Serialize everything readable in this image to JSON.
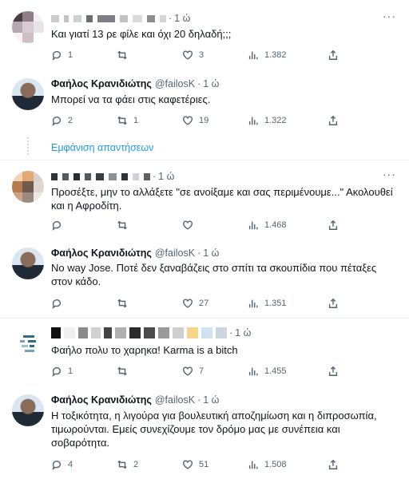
{
  "colors": {
    "link": "#1d9bf0",
    "muted": "#536471",
    "divider": "#eff3f4"
  },
  "tweets": [
    {
      "name": "",
      "handle": "",
      "time": "1 ώ",
      "text": "Και γιατί 13 ρε φίλε και όχι 20 δηλαδή;;;",
      "replies": "1",
      "retweets": "",
      "likes": "3",
      "views": "1.382"
    },
    {
      "name": "Φαήλος Κρανιδιώτης",
      "handle": "@failosK",
      "time": "1 ώ",
      "text": "Μπορεί να τα φάει στις καφετέριες.",
      "replies": "2",
      "retweets": "1",
      "likes": "19",
      "views": "1.322"
    },
    {
      "name": "",
      "handle": "",
      "time": "1 ώ",
      "text": "Προσέξτε, μην το αλλάξετε \"σε ανοίξαμε και σας περιμένουμε...\" Ακολουθεί και η Αφροδίτη.",
      "replies": "",
      "retweets": "",
      "likes": "",
      "views": "1.468"
    },
    {
      "name": "Φαήλος Κρανιδιώτης",
      "handle": "@failosK",
      "time": "1 ώ",
      "text": "No way Jose. Ποτέ δεν ξαναβάζεις στο σπίτι τα σκουπίδια που πέταξες στον κάδο.",
      "replies": "",
      "retweets": "",
      "likes": "27",
      "views": "1.351"
    },
    {
      "name": "",
      "handle": "",
      "time": "1 ώ",
      "text": "Φαήλο πολυ το χαρηκα! Karma is a bitch",
      "replies": "1",
      "retweets": "",
      "likes": "7",
      "views": "1.455"
    },
    {
      "name": "Φαήλος Κρανιδιώτης",
      "handle": "@failosK",
      "time": "1 ώ",
      "text": "Η τοξικότητα, η λιγούρα για βουλευτική αποζημίωση και η διπροσωπία, τιμωρούνται. Εμείς συνεχίζουμε τον δρόμο μας με συνέπεια και σοβαρότητα.",
      "replies": "4",
      "retweets": "2",
      "likes": "51",
      "views": "1.508"
    }
  ],
  "show_replies_label": "Εμφάνιση απαντήσεων",
  "more_label": "···",
  "dot": "·"
}
